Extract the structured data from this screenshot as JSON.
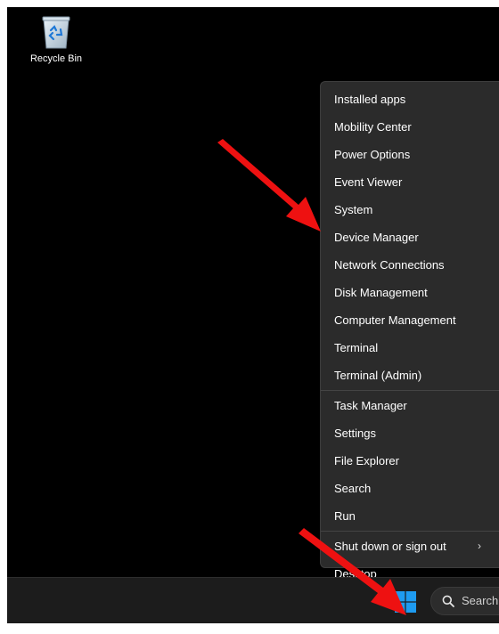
{
  "desktop": {
    "recycle_bin_label": "Recycle Bin"
  },
  "context_menu": {
    "group1": [
      "Installed apps",
      "Mobility Center",
      "Power Options",
      "Event Viewer",
      "System",
      "Device Manager",
      "Network Connections",
      "Disk Management",
      "Computer Management",
      "Terminal",
      "Terminal (Admin)"
    ],
    "group2": [
      "Task Manager",
      "Settings",
      "File Explorer",
      "Search",
      "Run"
    ],
    "group3": [
      "Shut down or sign out",
      "Desktop"
    ],
    "submenu_chevron": "›"
  },
  "taskbar": {
    "search_label": "Search"
  },
  "icons": {
    "recycle_bin": "recycle-bin-icon",
    "start": "windows-start-icon",
    "search": "search-icon"
  },
  "colors": {
    "desktop_background": "#000000",
    "menu_background": "#2b2b2b",
    "taskbar_background": "#1c1c1c",
    "windows_logo": "#1e9bf0",
    "annotation_arrow": "#ee1111"
  }
}
